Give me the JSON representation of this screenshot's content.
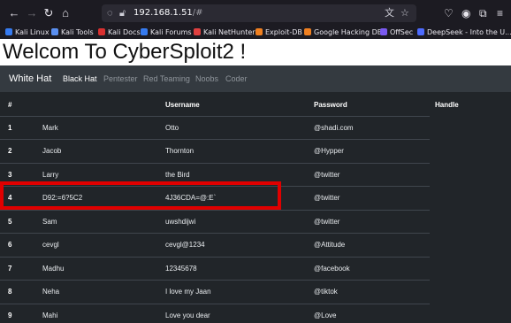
{
  "browser": {
    "url_host": "192.168.1.51",
    "url_path": "/#",
    "bookmarks": [
      "Kali Linux",
      "Kali Tools",
      "Kali Docs",
      "Kali Forums",
      "Kali NetHunter",
      "Exploit-DB",
      "Google Hacking DB",
      "OffSec",
      "DeepSeek - Into the U..."
    ]
  },
  "page": {
    "heading": "Welcom To CyberSploit2 !",
    "brand": "White Hat",
    "nav": [
      "Black Hat",
      "Pentester",
      "Red Teaming",
      "Noobs",
      "Coder"
    ]
  },
  "table": {
    "headers": [
      "#",
      "Username",
      "Password",
      "Handle"
    ],
    "rows": [
      {
        "num": "1",
        "name": "Mark",
        "username": "Otto",
        "password": "@shadi.com"
      },
      {
        "num": "2",
        "name": "Jacob",
        "username": "Thornton",
        "password": "@Hypper"
      },
      {
        "num": "3",
        "name": "Larry",
        "username": "the Bird",
        "password": "@twitter"
      },
      {
        "num": "4",
        "name": "D92:=6?5C2",
        "username": "4J36CDA=@:E`",
        "password": "@twitter"
      },
      {
        "num": "5",
        "name": "Sam",
        "username": "uwshdijwi",
        "password": "@twitter"
      },
      {
        "num": "6",
        "name": "cevgl",
        "username": "cevgl@1234",
        "password": "@Attitude"
      },
      {
        "num": "7",
        "name": "Madhu",
        "username": "12345678",
        "password": "@facebook"
      },
      {
        "num": "8",
        "name": "Neha",
        "username": "I love my Jaan",
        "password": "@tiktok"
      },
      {
        "num": "9",
        "name": "Mahi",
        "username": "Love you dear",
        "password": "@Love"
      }
    ]
  },
  "colors": {
    "table_bg": "#212529",
    "navbar_bg": "#343a40",
    "highlight": "#e00000"
  }
}
